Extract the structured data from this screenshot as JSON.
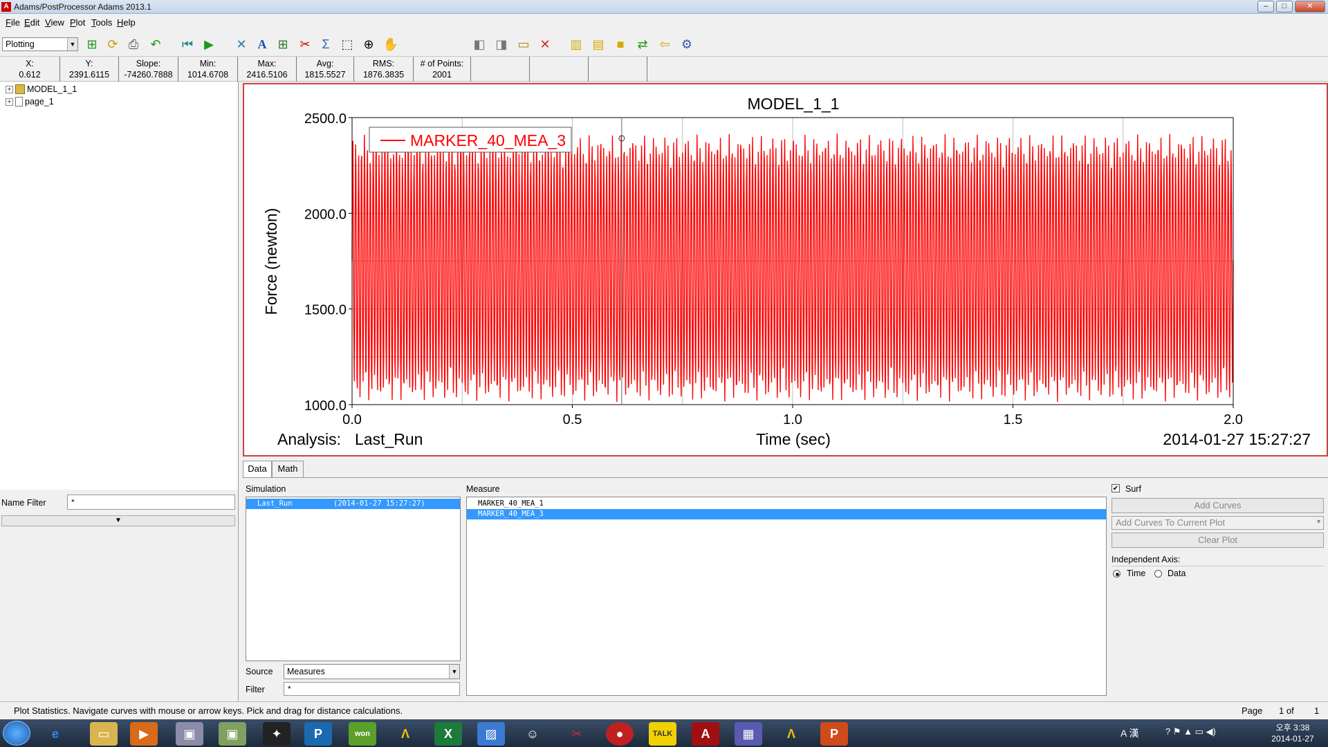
{
  "window": {
    "title": "Adams/PostProcessor Adams 2013.1",
    "app_icon": "A",
    "minimize": "–",
    "maximize": "□",
    "close": "✕"
  },
  "menu": [
    "File",
    "Edit",
    "View",
    "Plot",
    "Tools",
    "Help"
  ],
  "toolbar": {
    "mode_value": "Plotting"
  },
  "stats": [
    {
      "label": "X:",
      "value": "0.612"
    },
    {
      "label": "Y:",
      "value": "2391.6115"
    },
    {
      "label": "Slope:",
      "value": "-74260.7888"
    },
    {
      "label": "Min:",
      "value": "1014.6708"
    },
    {
      "label": "Max:",
      "value": "2416.5106"
    },
    {
      "label": "Avg:",
      "value": "1815.5527"
    },
    {
      "label": "RMS:",
      "value": "1876.3835"
    },
    {
      "label": "# of Points:",
      "value": "2001"
    }
  ],
  "tree": {
    "items": [
      "MODEL_1_1",
      "page_1"
    ]
  },
  "name_filter": {
    "label": "Name Filter",
    "value": "*"
  },
  "plot": {
    "analysis_label": "Analysis:",
    "analysis_value": "Last_Run",
    "timestamp": "2014-01-27 15:27:27",
    "cursor_x": 0.612
  },
  "chart_data": {
    "type": "line",
    "title": "MODEL_1_1",
    "xlabel": "Time (sec)",
    "ylabel": "Force (newton)",
    "xlim": [
      0.0,
      2.0
    ],
    "ylim": [
      1000.0,
      2500.0
    ],
    "x_ticks": [
      "0.0",
      "0.5",
      "1.0",
      "1.5",
      "2.0"
    ],
    "y_ticks": [
      "1000.0",
      "1500.0",
      "2000.0",
      "2500.0"
    ],
    "grid": true,
    "legend_position": "top-left",
    "series": [
      {
        "name": "MARKER_40_MEA_3",
        "color": "#ff0000",
        "x_start": 0.0,
        "x_end": 2.0,
        "points": 2001,
        "min": 1014.6708,
        "max": 2416.5106,
        "avg": 1815.5527,
        "rms": 1876.3835
      }
    ]
  },
  "tabs": [
    "Data",
    "Math"
  ],
  "simulation": {
    "label": "Simulation",
    "rows": [
      {
        "name": "Last_Run",
        "time": "(2014-01-27 15:27:27)"
      }
    ]
  },
  "measure": {
    "label": "Measure",
    "rows": [
      "MARKER_40_MEA_1",
      "MARKER_40_MEA_3"
    ],
    "selected": "MARKER_40_MEA_3"
  },
  "source": {
    "label": "Source",
    "value": "Measures"
  },
  "filter": {
    "label": "Filter",
    "value": "*"
  },
  "right": {
    "surf_label": "Surf",
    "add_curves": "Add Curves",
    "add_to_plot": "Add Curves To Current Plot",
    "clear_plot": "Clear Plot",
    "indep_axis": "Independent Axis:",
    "opt_time": "Time",
    "opt_data": "Data"
  },
  "status": {
    "message": "Plot Statistics.  Navigate curves with mouse or arrow keys.  Pick and drag for distance calculations.",
    "page_label": "Page",
    "page_num": "1 of",
    "page_total": "1"
  },
  "taskbar": {
    "time": "오후 3:38",
    "date": "2014-01-27",
    "tray_text": "A 漢"
  }
}
